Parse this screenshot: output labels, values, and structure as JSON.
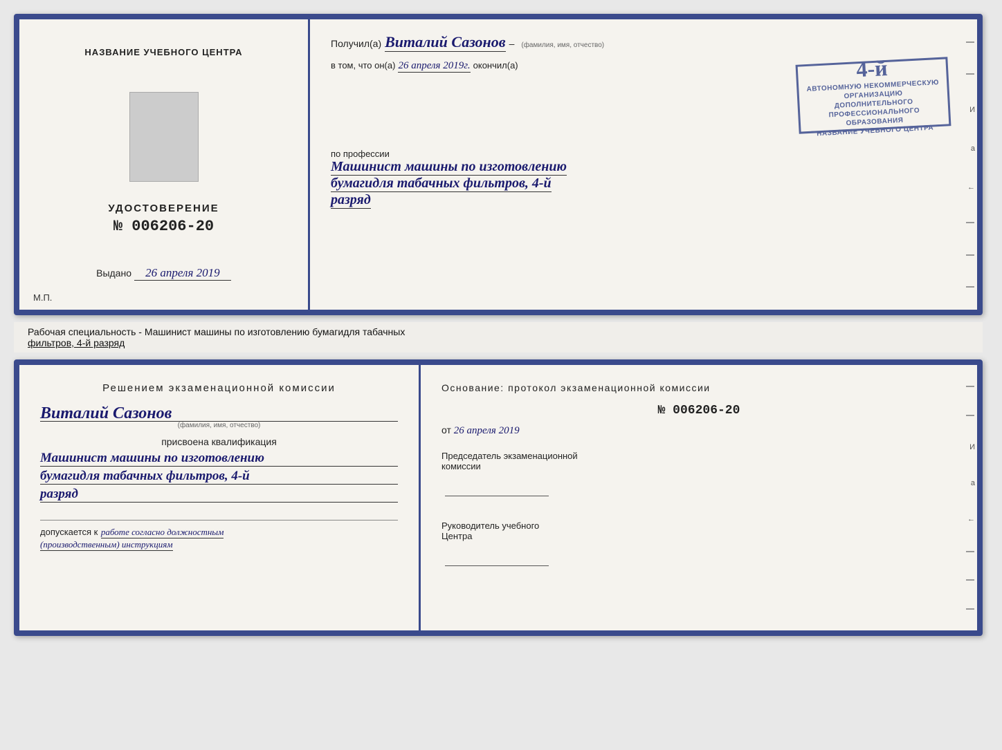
{
  "top_left": {
    "title": "НАЗВАНИЕ УЧЕБНОГО ЦЕНТРА",
    "photo_alt": "фото",
    "cert_label": "УДОСТОВЕРЕНИЕ",
    "cert_number": "№ 006206-20",
    "issued_label": "Выдано",
    "issued_date": "26 апреля 2019",
    "mp_label": "М.П."
  },
  "top_right": {
    "recipient_prefix": "Получил(а)",
    "recipient_name": "Виталий Сазонов",
    "recipient_sub": "(фамилия, имя, отчество)",
    "dash": "–",
    "in_that_prefix": "в том, что он(а)",
    "completion_date": "26 апреля 2019г.",
    "completed_label": "окончил(а)",
    "stamp_line1": "АВТОНОМНУЮ НЕКОММЕРЧЕСКУЮ ОРГАНИЗАЦИЮ",
    "stamp_line2": "ДОПОЛНИТЕЛЬНОГО ПРОФЕССИОНАЛЬНОГО ОБРАЗОВАНИЯ",
    "stamp_line3": "\" НАЗВАНИЕ УЧЕБНОГО ЦЕНТРА \"",
    "stamp_number_text": "4-й",
    "profession_prefix": "по профессии",
    "profession_line1": "Машинист машины по изготовлению",
    "profession_line2": "бумагидля табачных фильтров, 4-й",
    "profession_line3": "разряд"
  },
  "info_bar": {
    "text": "Рабочая специальность - Машинист машины по изготовлению бумагидля табачных",
    "text_underline": "фильтров, 4-й разряд"
  },
  "bottom_left": {
    "commission_title": "Решением  экзаменационной  комиссии",
    "name": "Виталий Сазонов",
    "name_sub": "(фамилия, имя, отчество)",
    "assigned_label": "присвоена квалификация",
    "qual_line1": "Машинист машины по изготовлению",
    "qual_line2": "бумагидля табачных фильтров, 4-й",
    "qual_line3": "разряд",
    "допуск_label": "допускается к",
    "допуск_italic": "работе согласно должностным",
    "допуск_italic2": "(производственным) инструкциям"
  },
  "bottom_right": {
    "osnov_title": "Основание:  протокол  экзаменационной  комиссии",
    "protocol_number": "№  006206-20",
    "date_from_label": "от",
    "date_from_value": "26 апреля 2019",
    "chairman_label": "Председатель экзаменационной",
    "chairman_label2": "комиссии",
    "head_label": "Руководитель учебного",
    "head_label2": "Центра"
  },
  "side_marks": {
    "letters": [
      "И",
      "а",
      "←"
    ],
    "dashes": [
      "–",
      "–",
      "–",
      "–"
    ]
  }
}
